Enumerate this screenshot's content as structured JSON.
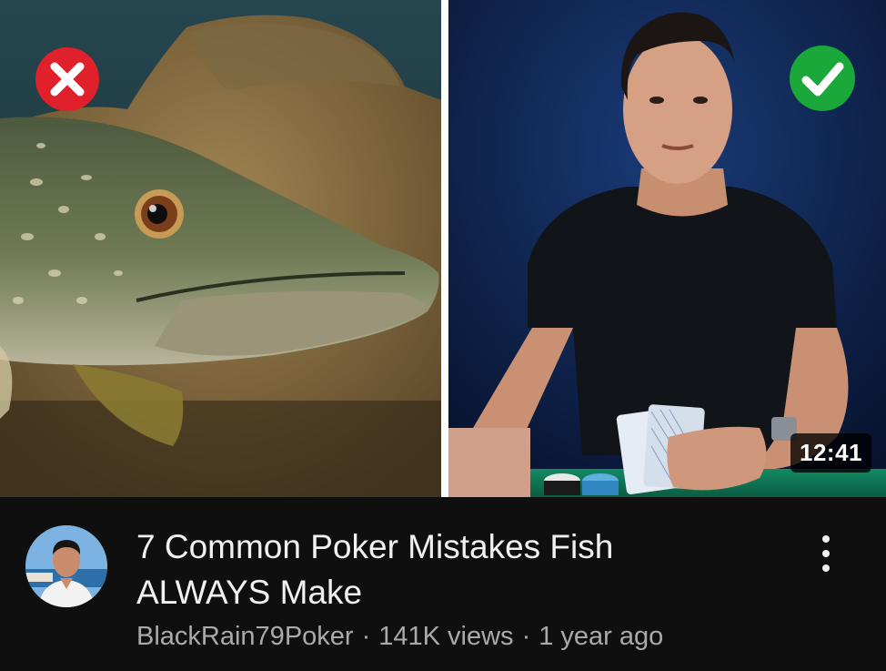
{
  "video": {
    "title_line1": "7 Common Poker Mistakes Fish",
    "title_line2": "ALWAYS Make",
    "duration": "12:41",
    "channel": "BlackRain79Poker",
    "views": "141K views",
    "age": "1 year ago",
    "separator": "·"
  },
  "thumbnail": {
    "left_icon": "red-x-icon",
    "right_icon": "green-check-icon",
    "left_scene": "pike-fish-underwater",
    "right_scene": "man-holding-poker-cards",
    "colors": {
      "x_red": "#e0202a",
      "check_green": "#1aa83a",
      "table_green": "#0f7a55"
    }
  },
  "icons": {
    "menu": "more-vertical-icon",
    "avatar": "channel-avatar"
  }
}
